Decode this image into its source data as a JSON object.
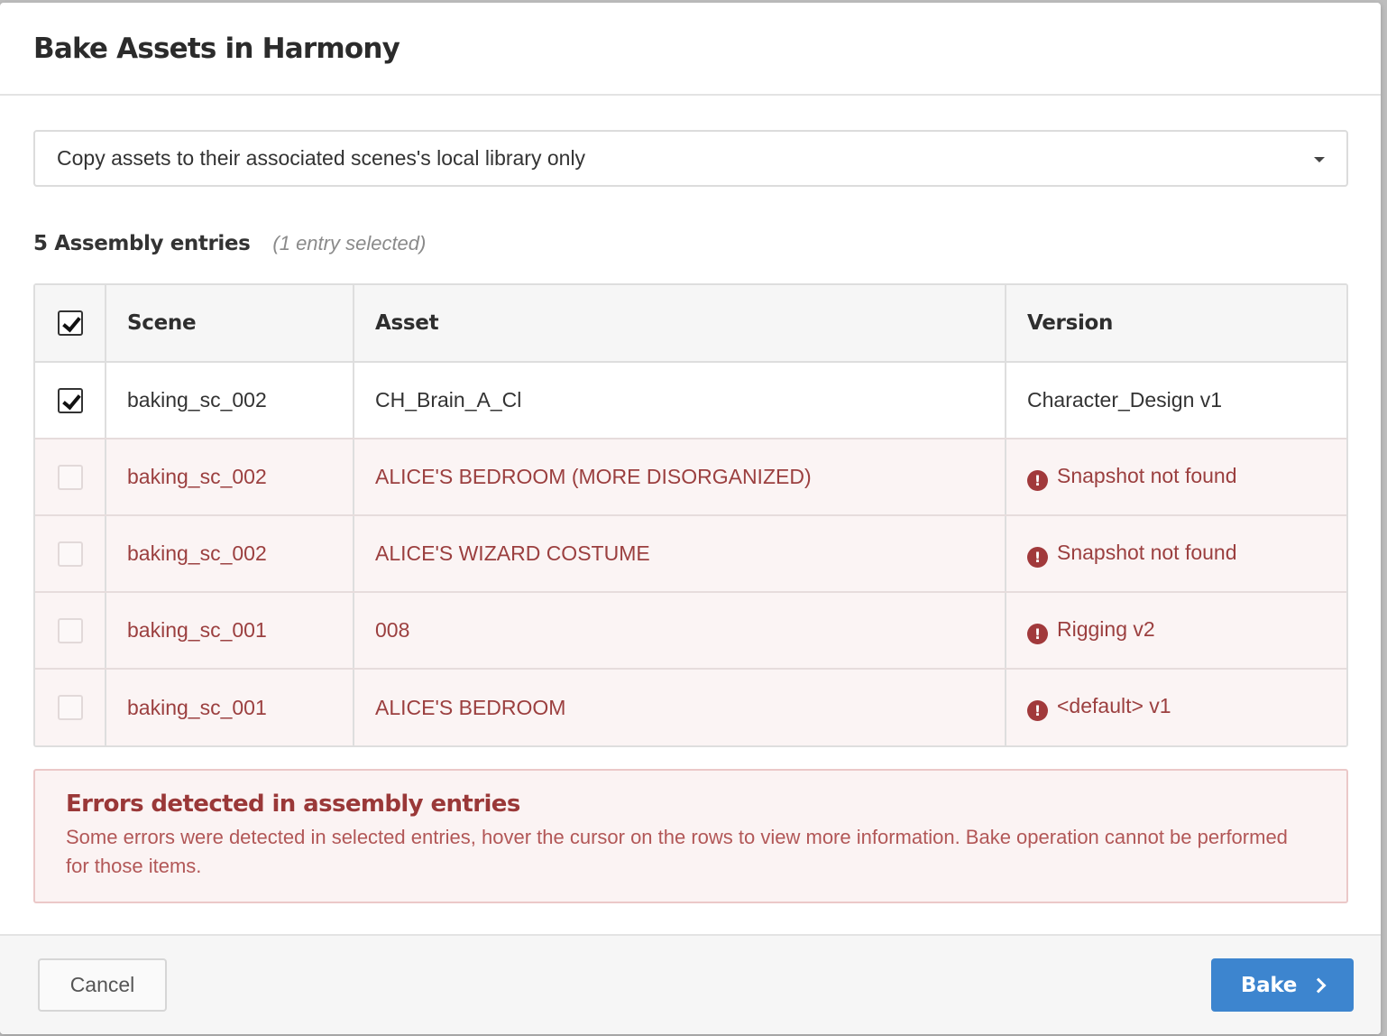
{
  "dialog": {
    "title": "Bake Assets in Harmony"
  },
  "mode_select": {
    "value": "Copy assets to their associated scenes's local library only"
  },
  "entries": {
    "count_label": "5 Assembly entries",
    "selected_label": "(1 entry selected)"
  },
  "table": {
    "headers": {
      "scene": "Scene",
      "asset": "Asset",
      "version": "Version"
    },
    "rows": [
      {
        "checked": true,
        "error": false,
        "scene": "baking_sc_002",
        "asset": "CH_Brain_A_Cl",
        "version": "Character_Design v1"
      },
      {
        "checked": false,
        "error": true,
        "scene": "baking_sc_002",
        "asset": "ALICE'S BEDROOM (MORE DISORGANIZED)",
        "version": "Snapshot not found"
      },
      {
        "checked": false,
        "error": true,
        "scene": "baking_sc_002",
        "asset": "ALICE'S WIZARD COSTUME",
        "version": "Snapshot not found"
      },
      {
        "checked": false,
        "error": true,
        "scene": "baking_sc_001",
        "asset": "008",
        "version": "Rigging v2"
      },
      {
        "checked": false,
        "error": true,
        "scene": "baking_sc_001",
        "asset": "ALICE'S BEDROOM",
        "version": "<default> v1"
      }
    ]
  },
  "error_panel": {
    "title": "Errors detected in assembly entries",
    "message": "Some errors were detected in selected entries, hover the cursor on the rows to view more information. Bake operation cannot be performed for those items."
  },
  "footer": {
    "cancel_label": "Cancel",
    "bake_label": "Bake"
  },
  "icons": {
    "error": "exclamation-circle-icon",
    "dropdown": "caret-down-icon",
    "next": "chevron-right-icon"
  },
  "colors": {
    "accent": "#3d85cf",
    "error_text": "#9b3f3f",
    "error_icon": "#a1393b",
    "error_bg": "#fbf4f4"
  }
}
